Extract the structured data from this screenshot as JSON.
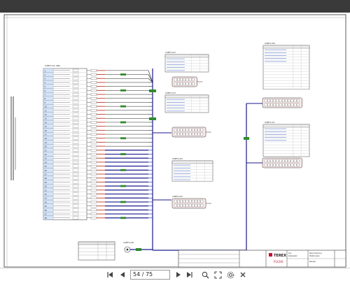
{
  "diagram": {
    "brand": "TEREX",
    "sub_brand": "FUCHS",
    "titlebox_labels": [
      "Typ",
      "Kabelsatz",
      "Beschreibung",
      "Elektroplan",
      "Bauteil"
    ],
    "left_connector_label": "X4BT1/X1-4BG",
    "left_connector_rows": [
      "1",
      "2",
      "3",
      "4",
      "5",
      "6",
      "7",
      "8",
      "9",
      "10",
      "11",
      "12",
      "13",
      "14",
      "15",
      "16",
      "17",
      "18",
      "19",
      "20",
      "21",
      "22",
      "23",
      "24",
      "25",
      "26",
      "27",
      "28",
      "29",
      "30",
      "31",
      "32",
      "33",
      "34",
      "35",
      "36",
      "37",
      "38"
    ],
    "mid_connector_labels": [
      "X4BT1/X2",
      "X4BT1/X3",
      "X4BT1/X4",
      "X4BT1/X5"
    ],
    "right_connector_labels": [
      "X4BT1/X6",
      "X4BT1/X7"
    ],
    "bottom_component_label": "X4BT1/X8"
  },
  "toolbar": {
    "page_current": "54",
    "page_total": "75",
    "page_display": "54 / 75",
    "icons": [
      "first-page-icon",
      "prev-page-icon",
      "next-page-icon",
      "last-page-icon",
      "zoom-icon",
      "fullscreen-icon",
      "settings-icon",
      "close-icon"
    ]
  },
  "colors": {
    "wire_blue": "#1a1a8c",
    "wire_black": "#222222",
    "wire_green_label": "#2e8b2e",
    "label_red": "#c0392b",
    "row_fill": "#d6e4f5",
    "terex_red": "#c8102e"
  }
}
